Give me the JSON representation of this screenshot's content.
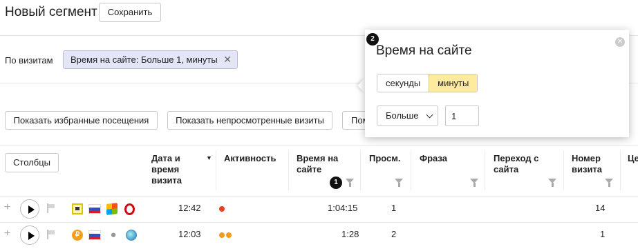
{
  "header": {
    "title": "Новый сегмент",
    "save_label": "Сохранить"
  },
  "filter_row": {
    "label": "По визитам",
    "chip_text": "Время на сайте: Больше 1, минуты",
    "chip_close": "✕"
  },
  "action_buttons": {
    "favorites": "Показать избранные посещения",
    "unviewed": "Показать непросмотренные визиты",
    "third": "Пом"
  },
  "table": {
    "columns_button": "Столбцы",
    "sort_indicator": "▼",
    "headers": {
      "datetime": "Дата и время визита",
      "activity": "Активность",
      "time_on_site": "Время на сайте",
      "views": "Просм.",
      "phrase": "Фраза",
      "referrer": "Переход с сайта",
      "visit_number": "Номер визита",
      "truncated": "Це"
    },
    "rows": [
      {
        "time": "12:42",
        "activity_dots": 1,
        "time_on_site": "1:04:15",
        "views": "1",
        "visit_number": "14",
        "source_icon": "window-icon",
        "os_icon": "windows-icon",
        "browser_icon": "opera-icon",
        "flag_icon": "russia-flag-icon"
      },
      {
        "time": "12:03",
        "activity_dots": 2,
        "time_on_site": "1:28",
        "views": "2",
        "visit_number": "1",
        "source_icon": "coin-icon",
        "os_icon": "apple-icon",
        "browser_icon": "globe-icon",
        "flag_icon": "russia-flag-icon"
      }
    ],
    "row2_source_glyph": "₽"
  },
  "popup": {
    "title": "Время на сайте",
    "units": [
      "секунды",
      "минуты"
    ],
    "active_unit": "минуты",
    "operator": "Больше",
    "value": "1",
    "close_glyph": "✕"
  },
  "badges": {
    "first": "1",
    "second": "2"
  },
  "colors": {
    "accent_yellow": "#ffeba0",
    "chip_bg": "#e4e6f8",
    "activity_dot": "#e8401c",
    "activity_dot_orange": "#f29b1a"
  }
}
